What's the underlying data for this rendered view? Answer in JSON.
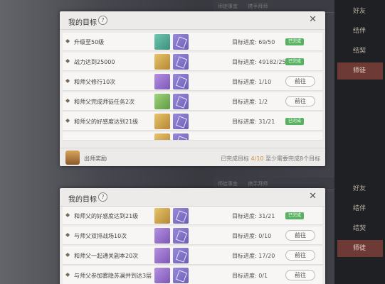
{
  "background": {
    "top_strip": [
      "师徒事宜",
      "携手拜师"
    ],
    "right_menu": [
      "好友",
      "结伴",
      "结契",
      "师徒"
    ],
    "right_menu_active_index": 3,
    "bottom_hint": "至少需要...目标"
  },
  "dialog_top": {
    "title": "我的目标",
    "help": "?",
    "close": "✕",
    "rows": [
      {
        "task": "升级至50级",
        "progress": "目标进度: 69/50",
        "status": "已完成",
        "reward1": "teal"
      },
      {
        "task": "战力达到25000",
        "progress": "目标进度: 49182/25000",
        "status": "已完成",
        "reward1": "gold"
      },
      {
        "task": "和师父修行10次",
        "progress": "目标进度: 1/10",
        "action": "前往",
        "reward1": "purple"
      },
      {
        "task": "和师父完成师徒任务2次",
        "progress": "目标进度: 1/2",
        "action": "前往",
        "reward1": "green"
      },
      {
        "task": "和师父的好感度达到21级",
        "progress": "目标进度: 31/21",
        "status": "已完成",
        "reward1": "gold"
      }
    ],
    "footer": {
      "label": "出师奖励",
      "completed_prefix": "已完成目标",
      "completed_count": "4/10",
      "requirement": "至少需要完成8个目标"
    }
  },
  "dialog_bottom": {
    "title": "我的目标",
    "help": "?",
    "close": "✕",
    "rows": [
      {
        "task": "和师父的好感度达到21级",
        "progress": "目标进度: 31/21",
        "status": "已完成",
        "reward1": "gold"
      },
      {
        "task": "与师父双排战场10次",
        "progress": "目标进度: 0/10",
        "action": "前往",
        "reward1": "purple"
      },
      {
        "task": "和师父一起通关副本20次",
        "progress": "目标进度: 17/20",
        "action": "前往",
        "reward1": "purple"
      },
      {
        "task": "与师父参加雾隐苏澜并到达3层",
        "progress": "目标进度: 0/1",
        "action": "前往",
        "reward1": "purple"
      }
    ]
  }
}
